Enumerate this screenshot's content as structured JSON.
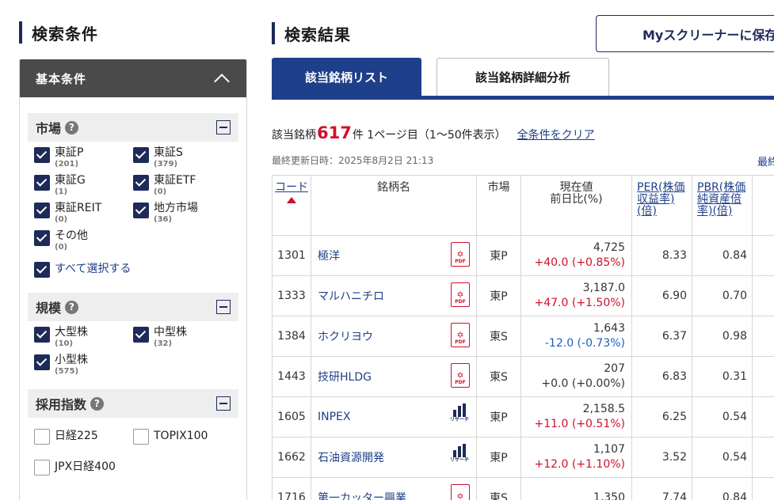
{
  "left": {
    "title": "検索条件",
    "panel_title": "基本条件",
    "groups": [
      {
        "title": "市場",
        "options": [
          {
            "label": "東証P",
            "count": "(201)",
            "checked": true
          },
          {
            "label": "東証S",
            "count": "(379)",
            "checked": true
          },
          {
            "label": "東証G",
            "count": "(1)",
            "checked": true
          },
          {
            "label": "東証ETF",
            "count": "(0)",
            "checked": true
          },
          {
            "label": "東証REIT",
            "count": "(0)",
            "checked": true
          },
          {
            "label": "地方市場",
            "count": "(36)",
            "checked": true
          },
          {
            "label": "その他",
            "count": "(0)",
            "checked": true
          }
        ],
        "select_all": "すべて選択する"
      },
      {
        "title": "規模",
        "options": [
          {
            "label": "大型株",
            "count": "(10)",
            "checked": true
          },
          {
            "label": "中型株",
            "count": "(32)",
            "checked": true
          },
          {
            "label": "小型株",
            "count": "(575)",
            "checked": true
          }
        ]
      },
      {
        "title": "採用指数",
        "options": [
          {
            "label": "日経225",
            "checked": false
          },
          {
            "label": "TOPIX100",
            "checked": false
          },
          {
            "label": "JPX日経400",
            "checked": false
          }
        ]
      }
    ]
  },
  "right": {
    "title": "検索結果",
    "save_button": "Myスクリーナーに保存",
    "tabs": [
      {
        "label": "該当銘柄リスト",
        "active": true
      },
      {
        "label": "該当銘柄詳細分析",
        "active": false
      }
    ],
    "result_prefix": "該当銘柄",
    "result_count": "617",
    "result_suffix": "件 1ページ目（1〜50件表示）",
    "clear_all": "全条件をクリア",
    "updated": "最終更新日時：2025年8月2日 21:13",
    "updated_right": "最終",
    "columns": {
      "code": "コード",
      "name": "銘柄名",
      "market": "市場",
      "price": "現在値\n前日比(%)",
      "per": "PER(株価収益率)(倍)",
      "pbr": "PBR(株価純資産倍率)(倍)"
    },
    "rows": [
      {
        "code": "1301",
        "name": "極洋",
        "icon": "pdf-icon",
        "market": "東P",
        "price": "4,725",
        "change": "+40.0 (+0.85%)",
        "dir": "up",
        "per": "8.33",
        "pbr": "0.84"
      },
      {
        "code": "1333",
        "name": "マルハニチロ",
        "icon": "pdf-icon",
        "market": "東P",
        "price": "3,187.0",
        "change": "+47.0 (+1.50%)",
        "dir": "up",
        "per": "6.90",
        "pbr": "0.70"
      },
      {
        "code": "1384",
        "name": "ホクリヨウ",
        "icon": "pdf-icon",
        "market": "東S",
        "price": "1,643",
        "change": "-12.0 (-0.73%)",
        "dir": "down",
        "per": "6.37",
        "pbr": "0.98"
      },
      {
        "code": "1443",
        "name": "技研HLDG",
        "icon": "pdf-icon",
        "market": "東S",
        "price": "207",
        "change": "+0.0 (+0.00%)",
        "dir": "flat",
        "per": "6.83",
        "pbr": "0.31"
      },
      {
        "code": "1605",
        "name": "INPEX",
        "icon": "research-icon",
        "market": "東P",
        "price": "2,158.5",
        "change": "+11.0 (+0.51%)",
        "dir": "up",
        "per": "6.25",
        "pbr": "0.54"
      },
      {
        "code": "1662",
        "name": "石油資源開発",
        "icon": "research-icon",
        "market": "東P",
        "price": "1,107",
        "change": "+12.0 (+1.10%)",
        "dir": "up",
        "per": "3.52",
        "pbr": "0.54"
      },
      {
        "code": "1716",
        "name": "第一カッター興業",
        "icon": "pdf-icon",
        "market": "東S",
        "price": "1,350",
        "change": "",
        "dir": "up",
        "per": "7.74",
        "pbr": "0.84"
      }
    ],
    "icon_texts": {
      "pdf": "PDF",
      "research": "リサーチ"
    }
  }
}
